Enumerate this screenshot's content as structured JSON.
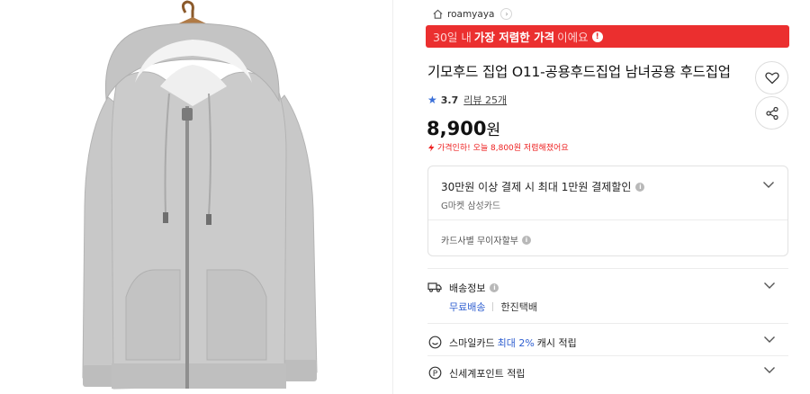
{
  "product_image": {
    "alt_name": "gray-zip-hoodie-image"
  },
  "seller": {
    "name": "roamyaya",
    "icon": "home-icon"
  },
  "price_banner": {
    "prefix": "30일 내",
    "highlight": "가장 저렴한 가격",
    "suffix": "이에요",
    "info_glyph": "!"
  },
  "product": {
    "title": "기모후드 집업 O11-공용후드집업 남녀공용 후드집업",
    "rating": "3.7",
    "reviews_label": "리뷰 25개",
    "price": "8,900",
    "price_unit": "원",
    "price_drop_note": "가격인하! 오늘 8,800원 저렴해졌어요"
  },
  "card_promo": {
    "title": "30만원 이상 결제 시 최대 1만원 결제할인",
    "subtitle": "G마켓 삼성카드",
    "installment": "카드사별 무이자할부"
  },
  "shipping": {
    "label": "배송정보",
    "free_shipping": "무료배송",
    "courier": "한진택배"
  },
  "smile_card": {
    "prefix": "스마일카드",
    "highlight": "최대 2%",
    "suffix": "캐시 적립"
  },
  "shinsegae_point": {
    "label": "신세계포인트 적립",
    "icon_glyph": "P"
  },
  "colors": {
    "banner_red": "#eb2f2f",
    "link_blue": "#2f5fd0",
    "star_blue": "#3a6fd8",
    "drop_red": "#e22222",
    "hoodie_gray": "#c9c9c9"
  }
}
